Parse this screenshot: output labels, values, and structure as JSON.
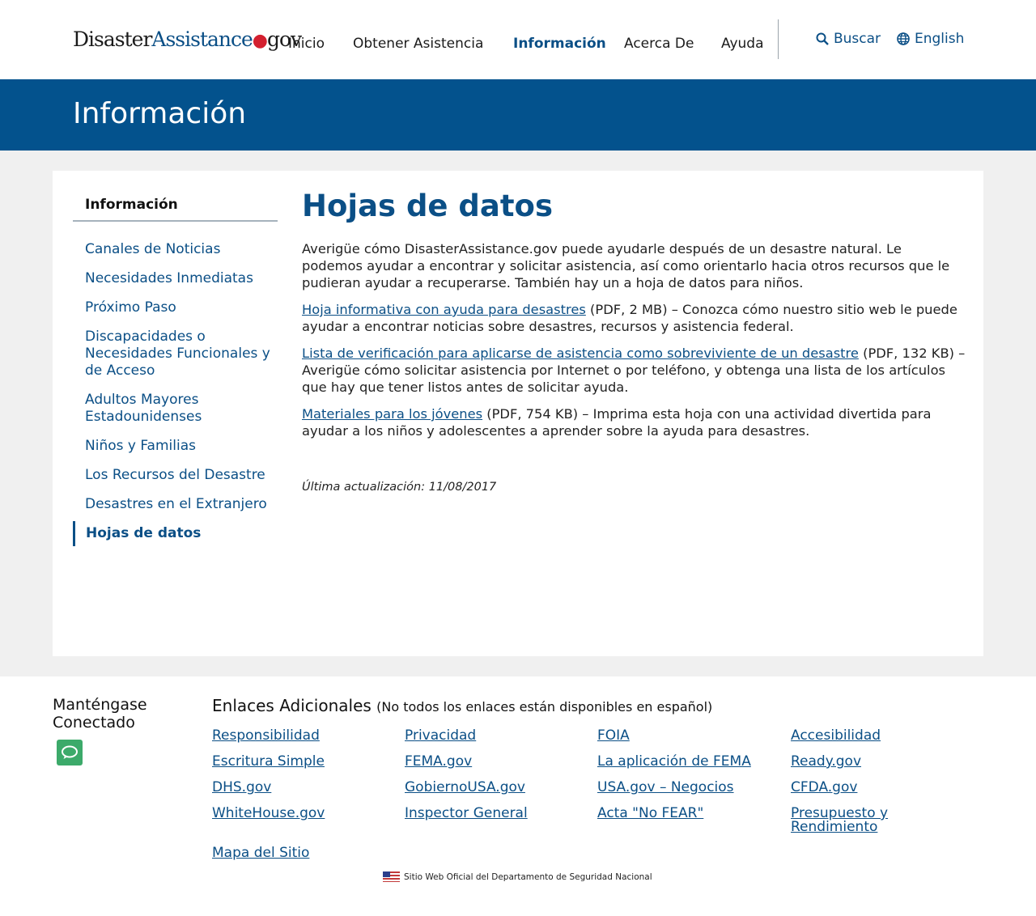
{
  "header": {
    "logo": {
      "part1": "Disaster",
      "part2": "Assistance",
      "dot": "●",
      "part3": "gov"
    },
    "nav": [
      "Inicio",
      "Obtener Asistencia",
      "Información",
      "Acerca De",
      "Ayuda"
    ],
    "search_label": "Buscar",
    "language_label": "English"
  },
  "banner": {
    "title": "Información"
  },
  "sidenav": {
    "title": "Información",
    "items": [
      "Canales de Noticias",
      "Necesidades Inmediatas",
      "Próximo Paso",
      "Discapacidades o Necesidades Funcionales y de Acceso",
      "Adultos Mayores Estadounidenses",
      "Niños y Familias",
      "Los Recursos del Desastre",
      "Desastres en el Extranjero",
      "Hojas de datos"
    ]
  },
  "main": {
    "title": "Hojas de datos",
    "intro": "Averigüe cómo DisasterAssistance.gov puede ayudarle después de un desastre natural. Le podemos ayudar a encontrar y solicitar asistencia, así como orientarlo hacia otros recursos que le pudieran ayudar a recuperarse. También hay un a hoja de datos para niños.",
    "items": [
      {
        "link": "Hoja informativa con ayuda para desastres",
        "text": " (PDF, 2 MB) – Conozca cómo nuestro sitio web le puede ayudar a encontrar noticias sobre desastres, recursos y asistencia federal."
      },
      {
        "link": "Lista de verificación para aplicarse de asistencia como sobreviviente de un desastre",
        "text": " (PDF, 132 KB) – Averigüe cómo solicitar asistencia por Internet o por teléfono, y obtenga una lista de los artículos que hay que tener listos antes de solicitar ayuda."
      },
      {
        "link": "Materiales para los jóvenes",
        "text": " (PDF, 754 KB) – Imprima esta hoja con una actividad divertida para ayudar a los niños y adolescentes a aprender sobre la ayuda para desastres."
      }
    ],
    "updated": "Última actualización: 11/08/2017"
  },
  "footer": {
    "stay_connected": "Manténgase Conectado",
    "links_title": "Enlaces Adicionales",
    "links_note": "(No todos los enlaces están disponibles en español)",
    "links": [
      "Responsibilidad",
      "Privacidad",
      "FOIA",
      "Accesibilidad",
      "Escritura Simple",
      "FEMA.gov",
      "La aplicación de FEMA",
      "Ready.gov",
      "DHS.gov",
      "GobiernoUSA.gov",
      "USA.gov – Negocios",
      "CFDA.gov",
      "WhiteHouse.gov",
      "Inspector General",
      "Acta \"No FEAR\"",
      "Presupuesto y Rendimiento",
      "Mapa del Sitio"
    ],
    "official": "Sitio Web Oficial del Departamento de Seguridad Nacional"
  },
  "colors": {
    "brand_blue": "#03528d",
    "link_blue": "#0b4f86",
    "accent_red": "#d3202f",
    "chat_green": "#3caa6a"
  }
}
